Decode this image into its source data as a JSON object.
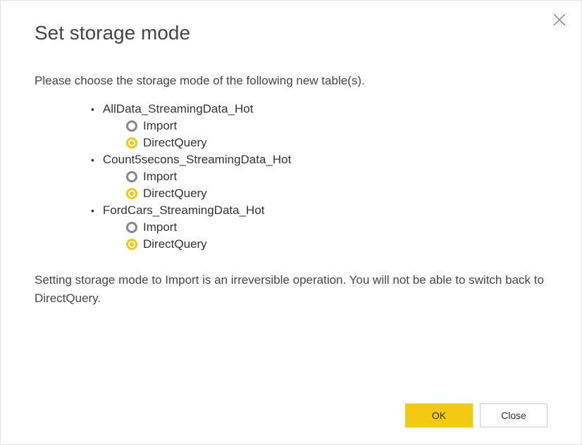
{
  "title": "Set storage mode",
  "intro": "Please choose the storage mode of the following new table(s).",
  "warning": "Setting storage mode to Import is an irreversible operation. You will not be able to switch back to DirectQuery.",
  "options": {
    "import": "Import",
    "directquery": "DirectQuery"
  },
  "tables": [
    {
      "name": "AllData_StreamingData_Hot",
      "selected": "directquery"
    },
    {
      "name": "Count5secons_StreamingData_Hot",
      "selected": "directquery"
    },
    {
      "name": "FordCars_StreamingData_Hot",
      "selected": "directquery"
    }
  ],
  "buttons": {
    "ok": "OK",
    "close": "Close"
  }
}
